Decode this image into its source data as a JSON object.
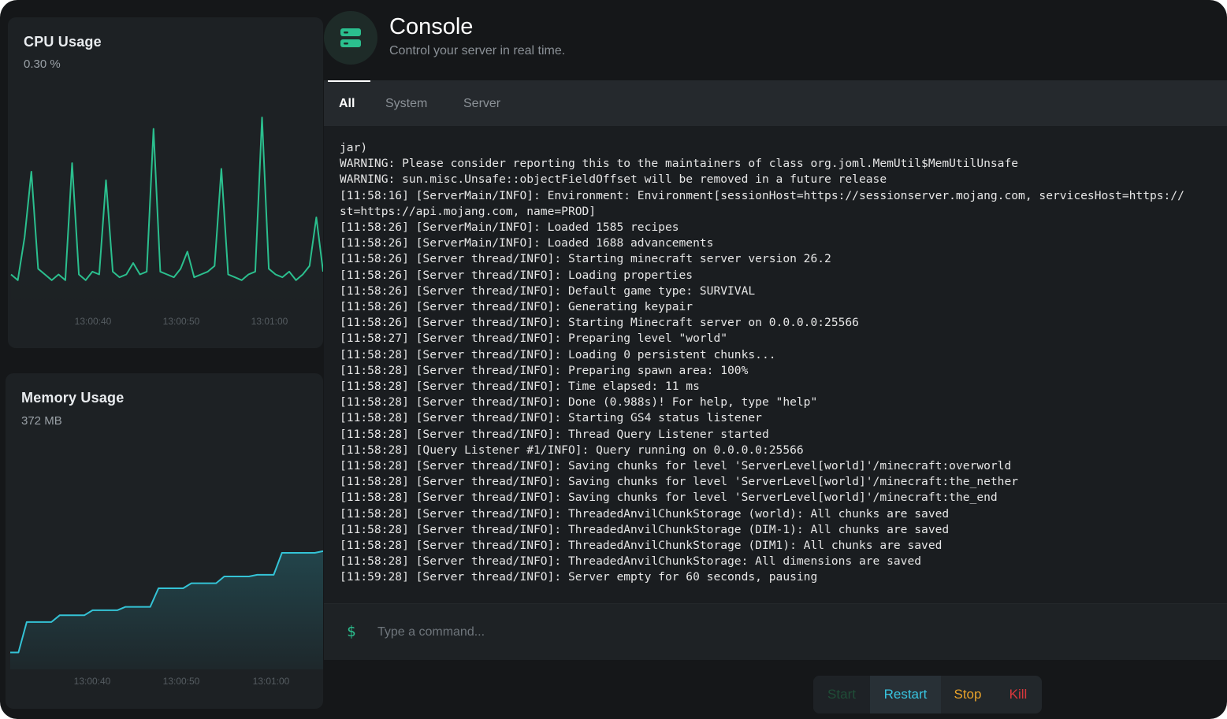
{
  "cpu_card": {
    "title": "CPU Usage",
    "value": "0.30 %"
  },
  "memory_card": {
    "title": "Memory Usage",
    "value": "372 MB"
  },
  "header": {
    "title": "Console",
    "subtitle": "Control your server in real time.",
    "logo_icon": "server-icon"
  },
  "tabs": [
    {
      "label": "All",
      "active": true
    },
    {
      "label": "System",
      "active": false
    },
    {
      "label": "Server",
      "active": false
    }
  ],
  "log_lines": [
    "jar)",
    "WARNING: Please consider reporting this to the maintainers of class org.joml.MemUtil$MemUtilUnsafe",
    "WARNING: sun.misc.Unsafe::objectFieldOffset will be removed in a future release",
    "[11:58:16] [ServerMain/INFO]: Environment: Environment[sessionHost=https://sessionserver.mojang.com, servicesHost=https://",
    "st=https://api.mojang.com, name=PROD]",
    "[11:58:26] [ServerMain/INFO]: Loaded 1585 recipes",
    "[11:58:26] [ServerMain/INFO]: Loaded 1688 advancements",
    "[11:58:26] [Server thread/INFO]: Starting minecraft server version 26.2",
    "[11:58:26] [Server thread/INFO]: Loading properties",
    "[11:58:26] [Server thread/INFO]: Default game type: SURVIVAL",
    "[11:58:26] [Server thread/INFO]: Generating keypair",
    "[11:58:26] [Server thread/INFO]: Starting Minecraft server on 0.0.0.0:25566",
    "[11:58:27] [Server thread/INFO]: Preparing level \"world\"",
    "[11:58:28] [Server thread/INFO]: Loading 0 persistent chunks...",
    "[11:58:28] [Server thread/INFO]: Preparing spawn area: 100%",
    "[11:58:28] [Server thread/INFO]: Time elapsed: 11 ms",
    "[11:58:28] [Server thread/INFO]: Done (0.988s)! For help, type \"help\"",
    "[11:58:28] [Server thread/INFO]: Starting GS4 status listener",
    "[11:58:28] [Server thread/INFO]: Thread Query Listener started",
    "[11:58:28] [Query Listener #1/INFO]: Query running on 0.0.0.0:25566",
    "[11:58:28] [Server thread/INFO]: Saving chunks for level 'ServerLevel[world]'/minecraft:overworld",
    "[11:58:28] [Server thread/INFO]: Saving chunks for level 'ServerLevel[world]'/minecraft:the_nether",
    "[11:58:28] [Server thread/INFO]: Saving chunks for level 'ServerLevel[world]'/minecraft:the_end",
    "[11:58:28] [Server thread/INFO]: ThreadedAnvilChunkStorage (world): All chunks are saved",
    "[11:58:28] [Server thread/INFO]: ThreadedAnvilChunkStorage (DIM-1): All chunks are saved",
    "[11:58:28] [Server thread/INFO]: ThreadedAnvilChunkStorage (DIM1): All chunks are saved",
    "[11:58:28] [Server thread/INFO]: ThreadedAnvilChunkStorage: All dimensions are saved",
    "[11:59:28] [Server thread/INFO]: Server empty for 60 seconds, pausing"
  ],
  "command": {
    "prompt": "$",
    "placeholder": "Type a command...",
    "value": ""
  },
  "actions": {
    "start": "Start",
    "restart": "Restart",
    "stop": "Stop",
    "kill": "Kill"
  },
  "colors": {
    "cpu_line": "#2bbf8e",
    "memory_line": "#34c3d6",
    "start": "#1f4d37",
    "restart": "#38c4e0",
    "stop": "#e8a22a",
    "kill": "#d9383c"
  },
  "chart_data": [
    {
      "type": "line",
      "series": [
        {
          "values": [
            1.2,
            1.0,
            2.5,
            4.8,
            1.4,
            1.2,
            1.0,
            1.2,
            1.0,
            5.1,
            1.2,
            1.0,
            1.3,
            1.2,
            4.5,
            1.3,
            1.1,
            1.2,
            1.6,
            1.2,
            1.3,
            6.3,
            1.3,
            1.2,
            1.1,
            1.4,
            2.0,
            1.1,
            1.2,
            1.3,
            1.5,
            4.9,
            1.2,
            1.1,
            1.0,
            1.2,
            1.3,
            6.7,
            1.4,
            1.2,
            1.1,
            1.3,
            1.0,
            1.2,
            1.5,
            3.2,
            1.3
          ]
        }
      ],
      "x_tick_labels": [
        "13:00:40",
        "13:00:50",
        "13:01:00"
      ],
      "grid": false,
      "ylim": [
        0,
        8
      ]
    },
    {
      "type": "area",
      "series": [
        {
          "values": [
            300,
            300,
            318,
            318,
            318,
            318,
            322,
            322,
            322,
            322,
            325,
            325,
            325,
            325,
            327,
            327,
            327,
            327,
            338,
            338,
            338,
            338,
            341,
            341,
            341,
            341,
            345,
            345,
            345,
            345,
            346,
            346,
            346,
            359,
            359,
            359,
            359,
            359,
            360
          ]
        }
      ],
      "x_tick_labels": [
        "13:00:40",
        "13:00:50",
        "13:01:00"
      ],
      "grid": false,
      "ylim": [
        290,
        400
      ]
    }
  ]
}
